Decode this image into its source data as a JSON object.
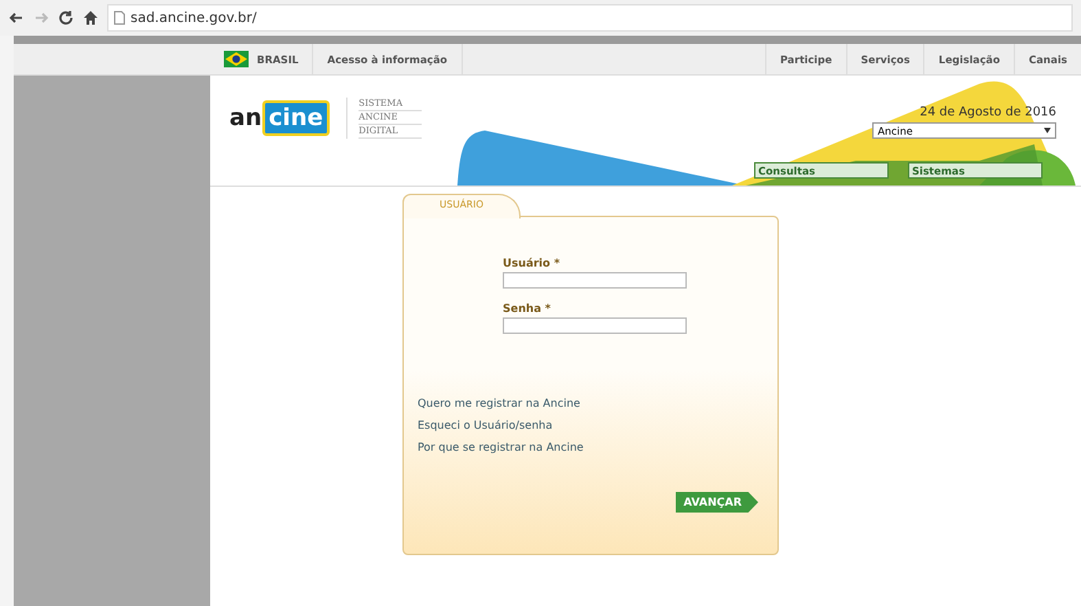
{
  "browser": {
    "url": "sad.ancine.gov.br/"
  },
  "nav": {
    "brand": "BRASIL",
    "left_links": [
      "Acesso à informação"
    ],
    "right_links": [
      "Participe",
      "Serviços",
      "Legislação",
      "Canais"
    ]
  },
  "header": {
    "logo": {
      "prefix": "an",
      "badge": "cine"
    },
    "system_name": [
      "SISTEMA",
      "ANCINE",
      "DIGITAL"
    ],
    "date": "24 de Agosto de 2016",
    "unit_select": {
      "value": "Ancine"
    },
    "menu_buttons": [
      "Consultas",
      "Sistemas"
    ]
  },
  "login": {
    "tab": "USUÁRIO",
    "fields": [
      {
        "label": "Usuário *"
      },
      {
        "label": "Senha *"
      }
    ],
    "links": [
      "Quero me registrar na Ancine",
      "Esqueci o Usuário/senha",
      "Por que se registrar na Ancine"
    ],
    "submit": "AVANÇAR"
  }
}
